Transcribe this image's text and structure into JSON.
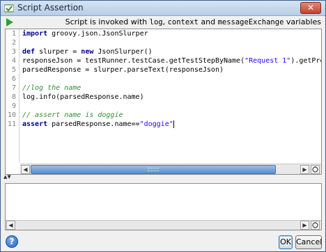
{
  "window": {
    "title": "Script Assertion",
    "close_label": "✕"
  },
  "toolbar": {
    "hint_prefix": "Script is invoked with ",
    "hint_log": "log",
    "hint_sep1": ", ",
    "hint_context": "context",
    "hint_sep2": " and ",
    "hint_messageExchange": "messageExchange",
    "hint_suffix": " variables"
  },
  "editor": {
    "line_numbers": [
      "1",
      "2",
      "3",
      "4",
      "5",
      "6",
      "7",
      "8",
      "9",
      "10",
      "11"
    ],
    "lines": [
      {
        "parts": [
          {
            "t": "import",
            "c": "kw"
          },
          {
            "t": " groovy.json.JsonSlurper",
            "c": ""
          }
        ]
      },
      {
        "parts": [
          {
            "t": "",
            "c": ""
          }
        ]
      },
      {
        "parts": [
          {
            "t": "def",
            "c": "kw"
          },
          {
            "t": " slurper = ",
            "c": ""
          },
          {
            "t": "new",
            "c": "kw"
          },
          {
            "t": " JsonSlurper()",
            "c": ""
          }
        ]
      },
      {
        "parts": [
          {
            "t": "responseJson = testRunner.testCase.getTestStepByName(",
            "c": ""
          },
          {
            "t": "\"Request 1\"",
            "c": "str"
          },
          {
            "t": ").getPropertyVa",
            "c": ""
          }
        ]
      },
      {
        "parts": [
          {
            "t": "parsedResponse = slurper.parseText(responseJson)",
            "c": ""
          }
        ]
      },
      {
        "parts": [
          {
            "t": "",
            "c": ""
          }
        ]
      },
      {
        "parts": [
          {
            "t": "//log the name",
            "c": "cm"
          }
        ]
      },
      {
        "parts": [
          {
            "t": "log.info(parsedResponse.name)",
            "c": ""
          }
        ]
      },
      {
        "parts": [
          {
            "t": "",
            "c": ""
          }
        ]
      },
      {
        "parts": [
          {
            "t": "// assert name is doggie",
            "c": "cm"
          }
        ]
      },
      {
        "parts": [
          {
            "t": "assert",
            "c": "kw"
          },
          {
            "t": " parsedResponse.name==",
            "c": ""
          },
          {
            "t": "\"doggie\"",
            "c": "str"
          }
        ]
      }
    ]
  },
  "scroll": {
    "left_arrow": "◀",
    "right_arrow": "▶",
    "split_up": "▲",
    "split_down": "▼"
  },
  "footer": {
    "help_label": "?",
    "ok_label": "OK",
    "cancel_label": "Cancel"
  }
}
